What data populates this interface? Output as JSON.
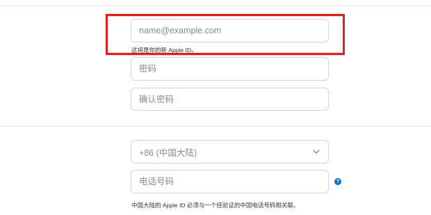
{
  "email": {
    "placeholder": "name@example.com",
    "value": "",
    "hint": "这将是你的新 Apple ID。"
  },
  "password": {
    "placeholder": "密码",
    "value": ""
  },
  "confirm_password": {
    "placeholder": "确认密码",
    "value": ""
  },
  "country": {
    "selected": "+86 (中国大陆)",
    "icon": "chevron-down-icon"
  },
  "phone": {
    "placeholder": "电话号码",
    "value": "",
    "hint": "中国大陆的 Apple ID 必须与一个经验证的中国电话号码相关联。",
    "help_icon_glyph": "?"
  },
  "colors": {
    "highlight": "#e21d1d",
    "help_icon": "#0b6fd8",
    "border": "#d2d2d7"
  }
}
